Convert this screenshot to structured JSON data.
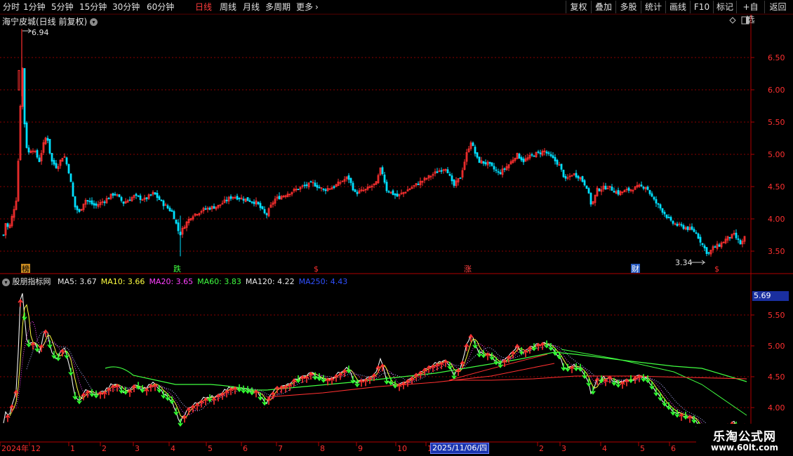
{
  "toolbar": {
    "periods": [
      "分时",
      "1分钟",
      "5分钟",
      "15分钟",
      "30分钟",
      "60分钟",
      "日线",
      "周线",
      "月线",
      "多周期",
      "更多"
    ],
    "active_period": "日线",
    "more_arrow": "›",
    "right_buttons": [
      "复权",
      "叠加",
      "多股",
      "统计",
      "画线",
      "F10",
      "标记",
      "+自选",
      "返回"
    ]
  },
  "main_chart": {
    "title": "海宁皮城(日线 前复权)",
    "y_ticks": [
      "6.50",
      "6.00",
      "5.50",
      "5.00",
      "4.50",
      "4.00",
      "3.50"
    ],
    "high_label": "6.94",
    "low_label": "3.34",
    "event_markers": [
      "榜",
      "跌",
      "$",
      "涨",
      "财",
      "$"
    ]
  },
  "indicator": {
    "name": "股朋指标网",
    "ma": [
      {
        "label": "MA5: 3.67",
        "color": "#e8e8e8"
      },
      {
        "label": "MA10: 3.66",
        "color": "#ffff40"
      },
      {
        "label": "MA20: 3.65",
        "color": "#ff40ff"
      },
      {
        "label": "MA60: 3.83",
        "color": "#40ff40"
      },
      {
        "label": "MA120: 4.22",
        "color": "#e8e8e8"
      },
      {
        "label": "MA250: 4.43",
        "color": "#3050ff"
      }
    ],
    "y_ticks": [
      "5.50",
      "5.00",
      "4.50",
      "4.00"
    ],
    "cursor_value": "5.69"
  },
  "x_axis": {
    "labels": [
      "2024年",
      "12",
      "1",
      "2",
      "3",
      "4",
      "5",
      "6",
      "7",
      "8",
      "9",
      "10",
      "1",
      "1",
      "2",
      "3",
      "4",
      "5",
      "6"
    ],
    "cursor_date": "2025/11/06/四"
  },
  "watermark": {
    "name": "乐淘公式网",
    "url": "www.60lt.com"
  },
  "colors": {
    "up": "#ff3030",
    "down": "#00e0ff",
    "grid": "#8b0000",
    "axis": "#b00000"
  }
}
